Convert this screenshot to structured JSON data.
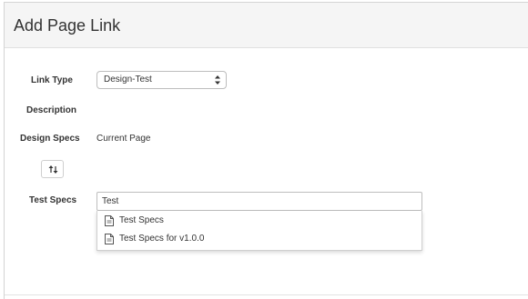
{
  "modal": {
    "title": "Add Page Link"
  },
  "form": {
    "link_type": {
      "label": "Link Type",
      "selected": "Design-Test"
    },
    "description": {
      "label": "Description"
    },
    "design_specs": {
      "label": "Design Specs",
      "value": "Current Page"
    },
    "swap_button": {
      "icon": "swap-vertical-arrows-icon"
    },
    "test_specs": {
      "label": "Test Specs",
      "input_value": "Test"
    }
  },
  "suggestions": [
    {
      "label": "Test Specs",
      "icon": "document-icon"
    },
    {
      "label": "Test Specs for v1.0.0",
      "icon": "document-icon"
    }
  ]
}
